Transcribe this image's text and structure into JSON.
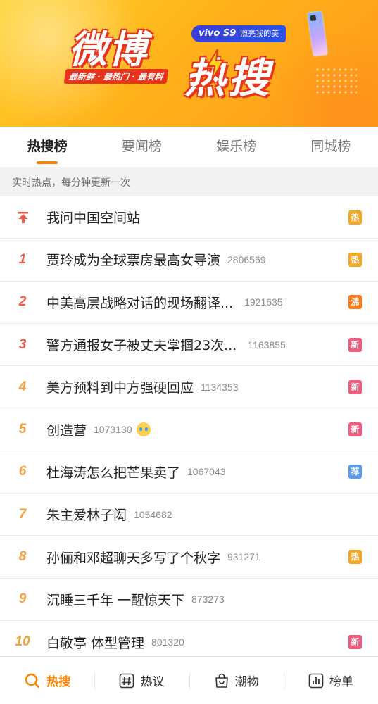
{
  "banner": {
    "title_line1": "微博",
    "title_line2": "热搜",
    "slogan": "最新鲜 · 最热门 · 最有料",
    "ad_brand": "vivo S9",
    "ad_tagline": "照亮我的美"
  },
  "tabs": [
    {
      "label": "热搜榜",
      "active": true
    },
    {
      "label": "要闻榜",
      "active": false
    },
    {
      "label": "娱乐榜",
      "active": false
    },
    {
      "label": "同城榜",
      "active": false
    }
  ],
  "notice": "实时热点，每分钟更新一次",
  "list": [
    {
      "rank": "",
      "pinned": true,
      "title": "我问中国空间站",
      "count": "",
      "badge": "热",
      "badge_color": "#f5a623"
    },
    {
      "rank": "1",
      "title": "贾玲成为全球票房最高女导演",
      "count": "2806569",
      "badge": "热",
      "badge_color": "#f5a623"
    },
    {
      "rank": "2",
      "title": "中美高层战略对话的现场翻译...",
      "count": "1921635",
      "badge": "沸",
      "badge_color": "#ff7a1a"
    },
    {
      "rank": "3",
      "title": "警方通报女子被丈夫掌掴23次...",
      "count": "1163855",
      "badge": "新",
      "badge_color": "#ef5d7e"
    },
    {
      "rank": "4",
      "title": "美方预料到中方强硬回应",
      "count": "1134353",
      "badge": "新",
      "badge_color": "#ef5d7e"
    },
    {
      "rank": "5",
      "title": "创造营",
      "count": "1073130",
      "emoji": "crying-face-icon",
      "badge": "新",
      "badge_color": "#ef5d7e"
    },
    {
      "rank": "6",
      "title": "杜海涛怎么把芒果卖了",
      "count": "1067043",
      "badge": "荐",
      "badge_color": "#5b9bea"
    },
    {
      "rank": "7",
      "title": "朱主爱林子闳",
      "count": "1054682",
      "badge": "",
      "badge_color": ""
    },
    {
      "rank": "8",
      "title": "孙俪和邓超聊天多写了个秋字",
      "count": "931271",
      "badge": "热",
      "badge_color": "#f5a623"
    },
    {
      "rank": "9",
      "title": "沉睡三千年 一醒惊天下",
      "count": "873273",
      "badge": "",
      "badge_color": ""
    },
    {
      "rank": "10",
      "title": "白敬亭 体型管理",
      "count": "801320",
      "badge": "新",
      "badge_color": "#ef5d7e"
    }
  ],
  "bottom_nav": [
    {
      "label": "热搜",
      "icon": "search-icon",
      "active": true
    },
    {
      "label": "热议",
      "icon": "hashtag-icon",
      "active": false
    },
    {
      "label": "潮物",
      "icon": "shopping-bag-icon",
      "active": false
    },
    {
      "label": "榜单",
      "icon": "bar-chart-icon",
      "active": false
    }
  ],
  "colors": {
    "accent": "#ff8200",
    "rank_top": "#ee5a4b",
    "rank_other": "#f0a23b"
  }
}
